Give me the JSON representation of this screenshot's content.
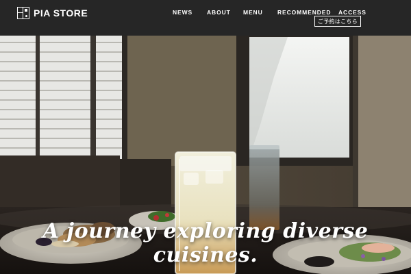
{
  "brand": {
    "name": "PIA STORE"
  },
  "nav": {
    "news": "NEWS",
    "about": "ABOUT",
    "menu": "MENU",
    "recommended": "RECOMMENDED",
    "access": "ACCESS"
  },
  "reserve_button": "ご予約はこちら",
  "hero": {
    "tagline": "A journey exploring diverse cuisines."
  },
  "colors": {
    "header_bg": "#262626",
    "text": "#ffffff"
  }
}
